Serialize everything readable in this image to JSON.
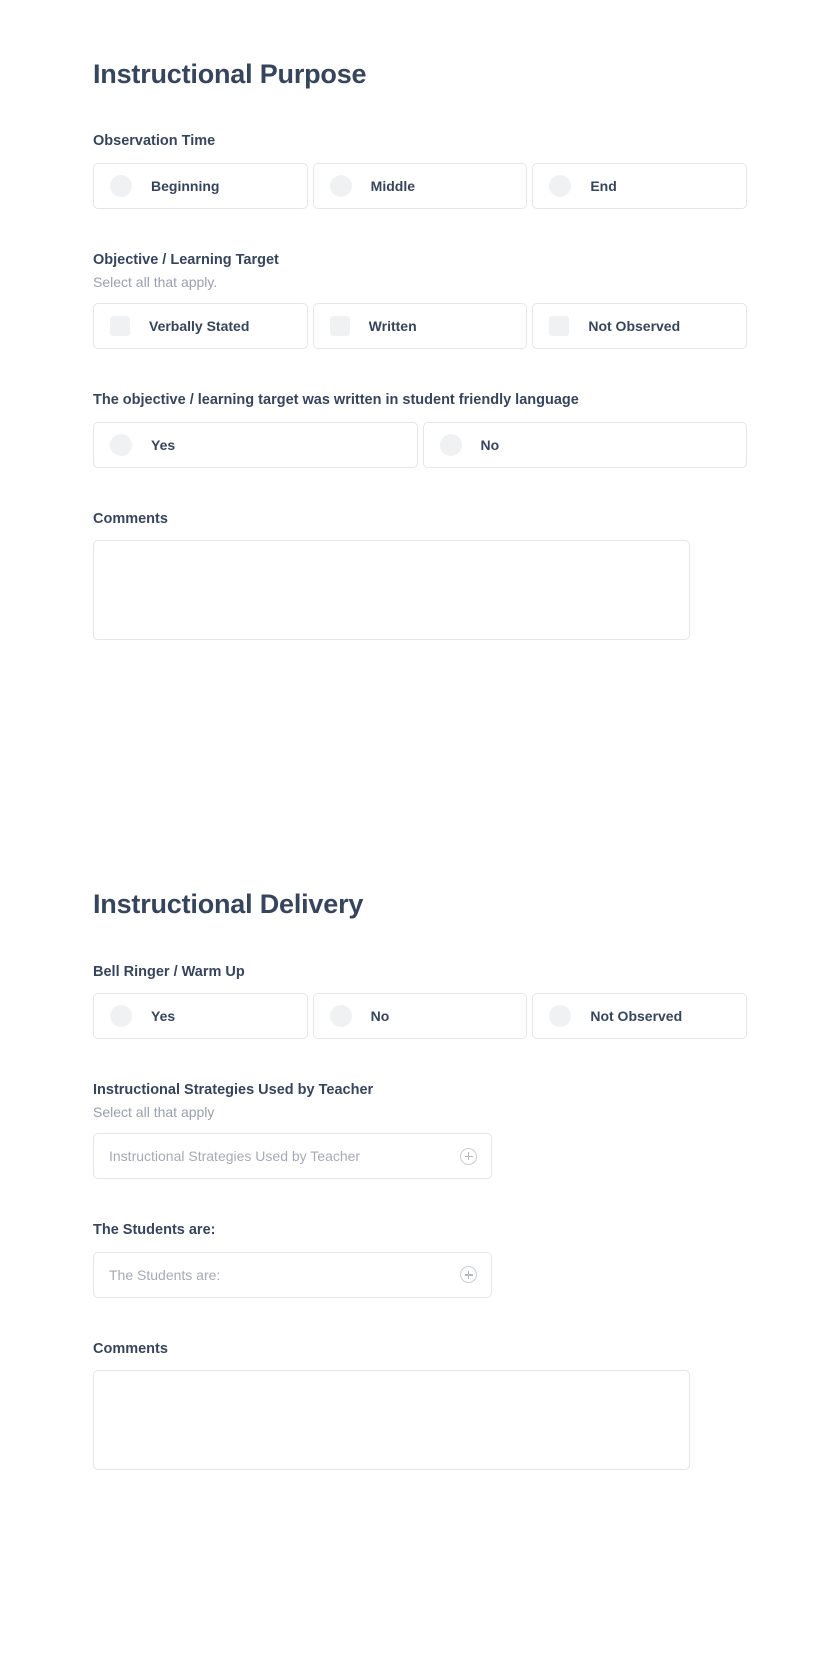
{
  "theme": {
    "text_dark": "#37455c",
    "text_muted": "#9a9fad",
    "placeholder": "#a6aab6",
    "border": "#e4e6ea",
    "control_fill": "#f0f1f3",
    "background": "#ffffff"
  },
  "sections": [
    {
      "title": "Instructional Purpose",
      "fields": [
        {
          "label": "Observation Time",
          "help": "",
          "control": "radio",
          "columns": 3,
          "options": [
            {
              "label": "Beginning"
            },
            {
              "label": "Middle"
            },
            {
              "label": "End"
            }
          ]
        },
        {
          "label": "Objective / Learning Target",
          "help": "Select all that apply.",
          "control": "checkbox",
          "columns": 3,
          "options": [
            {
              "label": "Verbally Stated"
            },
            {
              "label": "Written"
            },
            {
              "label": "Not Observed"
            }
          ]
        },
        {
          "label": "The objective / learning target was written in student friendly language",
          "help": "",
          "control": "radio",
          "columns": 2,
          "options": [
            {
              "label": "Yes"
            },
            {
              "label": "No"
            }
          ]
        },
        {
          "label": "Comments",
          "help": "",
          "control": "textarea",
          "value": "",
          "placeholder": ""
        }
      ]
    },
    {
      "title": "Instructional Delivery",
      "fields": [
        {
          "label": "Bell Ringer / Warm Up",
          "help": "",
          "control": "radio",
          "columns": 3,
          "options": [
            {
              "label": "Yes"
            },
            {
              "label": "No"
            },
            {
              "label": "Not Observed"
            }
          ]
        },
        {
          "label": "Instructional Strategies Used by Teacher",
          "help": "Select all that apply",
          "control": "picker",
          "placeholder": "Instructional Strategies Used by Teacher",
          "icon": "plus-circle-icon"
        },
        {
          "label": "The Students are:",
          "help": "",
          "control": "picker",
          "placeholder": "The Students are:",
          "icon": "plus-circle-icon"
        },
        {
          "label": "Comments",
          "help": "",
          "control": "textarea",
          "value": "",
          "placeholder": ""
        }
      ]
    }
  ]
}
